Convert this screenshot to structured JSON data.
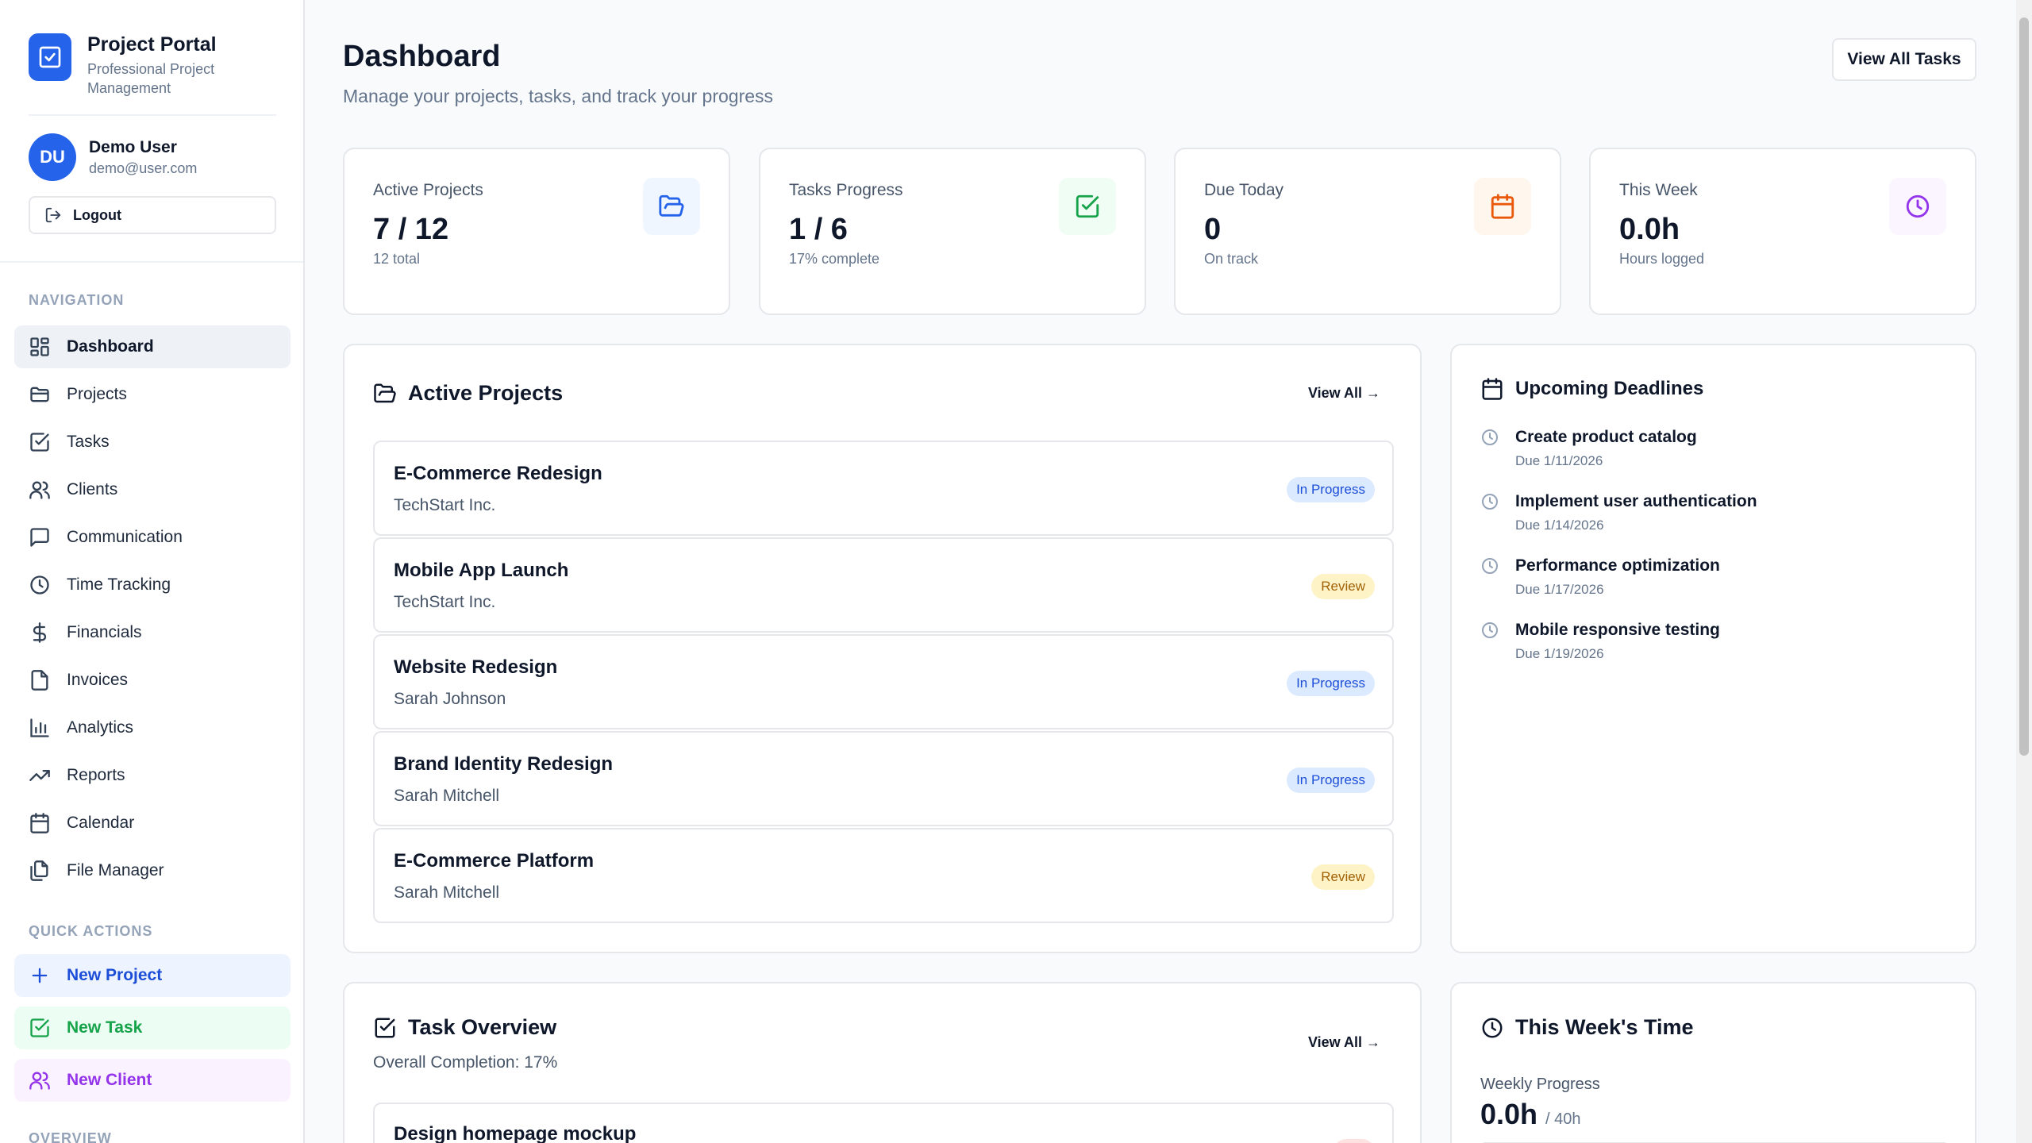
{
  "app": {
    "title": "Project Portal",
    "subtitle": "Professional Project Management"
  },
  "user": {
    "initials": "DU",
    "name": "Demo User",
    "email": "demo@user.com",
    "logout_label": "Logout"
  },
  "navigation": {
    "section_label": "NAVIGATION",
    "items": [
      {
        "label": "Dashboard",
        "icon": "grid-icon",
        "active": true
      },
      {
        "label": "Projects",
        "icon": "folder-icon"
      },
      {
        "label": "Tasks",
        "icon": "check-square-icon"
      },
      {
        "label": "Clients",
        "icon": "users-icon"
      },
      {
        "label": "Communication",
        "icon": "message-icon"
      },
      {
        "label": "Time Tracking",
        "icon": "clock-icon"
      },
      {
        "label": "Financials",
        "icon": "dollar-icon"
      },
      {
        "label": "Invoices",
        "icon": "file-icon"
      },
      {
        "label": "Analytics",
        "icon": "bar-chart-icon"
      },
      {
        "label": "Reports",
        "icon": "trending-up-icon"
      },
      {
        "label": "Calendar",
        "icon": "calendar-icon"
      },
      {
        "label": "File Manager",
        "icon": "files-icon"
      }
    ]
  },
  "quick_actions": {
    "section_label": "QUICK ACTIONS",
    "items": [
      {
        "label": "New Project",
        "icon": "plus-icon",
        "color": "#1d4ed8"
      },
      {
        "label": "New Task",
        "icon": "check-square-icon",
        "color": "#16a34a"
      },
      {
        "label": "New Client",
        "icon": "users-icon",
        "color": "#9333ea"
      }
    ]
  },
  "overview_label": "OVERVIEW",
  "header": {
    "title": "Dashboard",
    "subtitle": "Manage your projects, tasks, and track your progress",
    "view_all_tasks": "View All Tasks"
  },
  "stats": [
    {
      "label": "Active Projects",
      "value": "7 / 12",
      "hint": "12 total",
      "icon": "folder-open-icon",
      "color": "#2563eb",
      "bg": "#eff6ff"
    },
    {
      "label": "Tasks Progress",
      "value": "1 / 6",
      "hint": "17% complete",
      "icon": "check-square-icon",
      "color": "#16a34a",
      "bg": "#f0fdf4"
    },
    {
      "label": "Due Today",
      "value": "0",
      "hint": "On track",
      "icon": "calendar-icon",
      "color": "#ea580c",
      "bg": "#fff7ed"
    },
    {
      "label": "This Week",
      "value": "0.0h",
      "hint": "Hours logged",
      "icon": "clock-icon",
      "color": "#9333ea",
      "bg": "#faf5ff"
    }
  ],
  "active_projects": {
    "title": "Active Projects",
    "view_all": "View All →",
    "items": [
      {
        "name": "E-Commerce Redesign",
        "client": "TechStart Inc.",
        "status": "In Progress"
      },
      {
        "name": "Mobile App Launch",
        "client": "TechStart Inc.",
        "status": "Review"
      },
      {
        "name": "Website Redesign",
        "client": "Sarah Johnson",
        "status": "In Progress"
      },
      {
        "name": "Brand Identity Redesign",
        "client": "Sarah Mitchell",
        "status": "In Progress"
      },
      {
        "name": "E-Commerce Platform",
        "client": "Sarah Mitchell",
        "status": "Review"
      }
    ]
  },
  "upcoming_deadlines": {
    "title": "Upcoming Deadlines",
    "items": [
      {
        "title": "Create product catalog",
        "due": "Due 1/11/2026"
      },
      {
        "title": "Implement user authentication",
        "due": "Due 1/14/2026"
      },
      {
        "title": "Performance optimization",
        "due": "Due 1/17/2026"
      },
      {
        "title": "Mobile responsive testing",
        "due": "Due 1/19/2026"
      }
    ]
  },
  "task_overview": {
    "title": "Task Overview",
    "view_all": "View All →",
    "completion": "Overall Completion: 17%",
    "first_task": "Design homepage mockup"
  },
  "weekly_time": {
    "title": "This Week's Time",
    "label": "Weekly Progress",
    "value": "0.0h",
    "target": "/ 40h",
    "progress": 0
  }
}
